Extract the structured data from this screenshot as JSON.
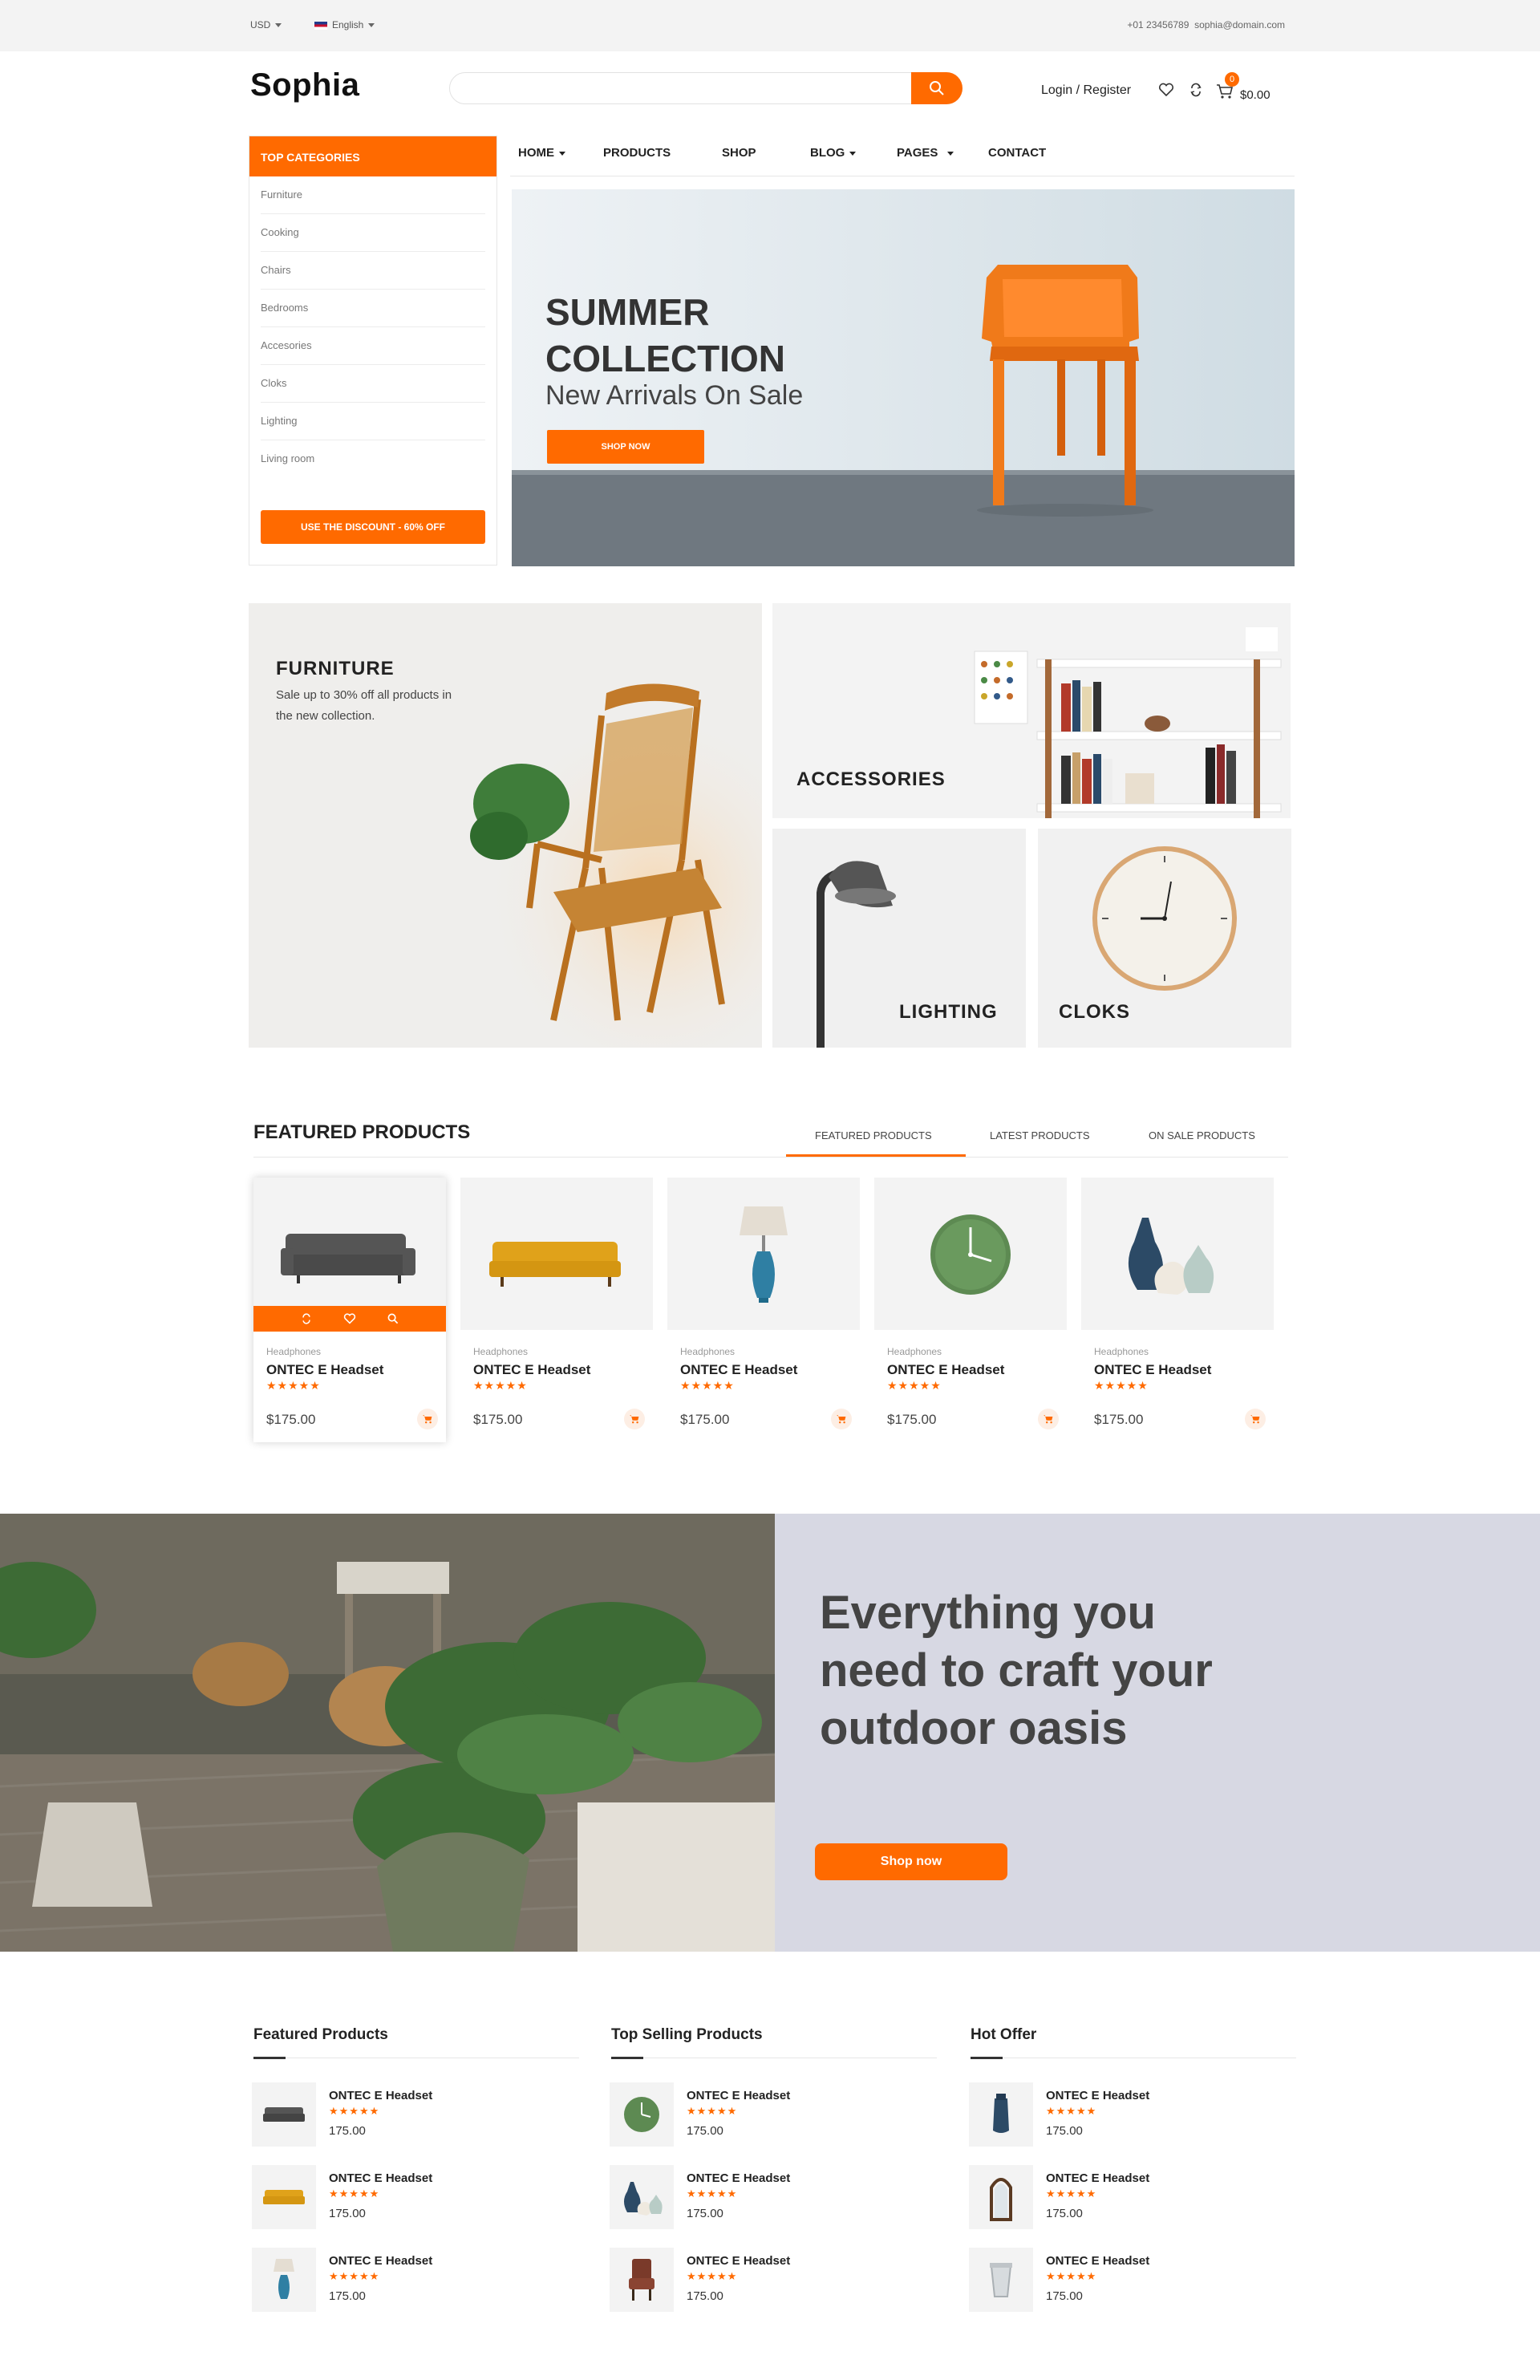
{
  "topbar": {
    "currency": "USD",
    "language": "English",
    "phone": "+01 23456789",
    "email": "sophia@domain.com"
  },
  "header": {
    "logo": "Sophia",
    "search_placeholder": "",
    "login": "Login / Register",
    "cart_count": "0",
    "cart_total": "$0.00"
  },
  "sidebar": {
    "title": "TOP CATEGORIES",
    "items": [
      "Furniture",
      "Cooking",
      "Chairs",
      "Bedrooms",
      "Accesories",
      "Cloks",
      "Lighting",
      "Living room"
    ],
    "discount_button": "USE THE DISCOUNT - 60% OFF"
  },
  "nav": {
    "items": [
      "HOME",
      "PRODUCTS",
      "SHOP",
      "BLOG",
      "PAGES",
      "CONTACT"
    ]
  },
  "hero": {
    "title": "SUMMER COLLECTION",
    "subtitle": "New Arrivals On Sale",
    "button": "SHOP NOW"
  },
  "banners": {
    "furniture_title": "FURNITURE",
    "furniture_desc": "Sale up to 30% off all products in the new collection.",
    "accessories": "ACCESSORIES",
    "lighting": "LIGHTING",
    "cloks": "CLOKS"
  },
  "featured": {
    "title": "FEATURED PRODUCTS",
    "tabs": [
      "FEATURED PRODUCTS",
      "LATEST PRODUCTS",
      "ON SALE PRODUCTS"
    ],
    "products": [
      {
        "category": "Headphones",
        "name": "ONTEC E Headset",
        "stars": "★★★★★",
        "price": "$175.00",
        "icon": "sofa-grey"
      },
      {
        "category": "Headphones",
        "name": "ONTEC E Headset",
        "stars": "★★★★★",
        "price": "$175.00",
        "icon": "sofa-yellow"
      },
      {
        "category": "Headphones",
        "name": "ONTEC E Headset",
        "stars": "★★★★★",
        "price": "$175.00",
        "icon": "table-lamp"
      },
      {
        "category": "Headphones",
        "name": "ONTEC E Headset",
        "stars": "★★★★★",
        "price": "$175.00",
        "icon": "wall-clock"
      },
      {
        "category": "Headphones",
        "name": "ONTEC E Headset",
        "stars": "★★★★★",
        "price": "$175.00",
        "icon": "vases"
      }
    ]
  },
  "outdoor": {
    "title": "Everything you need to craft your outdoor oasis",
    "button": "Shop now"
  },
  "lists": [
    {
      "title": "Featured Products",
      "items": [
        {
          "name": "ONTEC E Headset",
          "stars": "★★★★★",
          "price": "175.00",
          "icon": "sofa-grey"
        },
        {
          "name": "ONTEC E Headset",
          "stars": "★★★★★",
          "price": "175.00",
          "icon": "sofa-yellow"
        },
        {
          "name": "ONTEC E Headset",
          "stars": "★★★★★",
          "price": "175.00",
          "icon": "table-lamp"
        }
      ]
    },
    {
      "title": "Top Selling Products",
      "items": [
        {
          "name": "ONTEC E Headset",
          "stars": "★★★★★",
          "price": "175.00",
          "icon": "wall-clock"
        },
        {
          "name": "ONTEC E Headset",
          "stars": "★★★★★",
          "price": "175.00",
          "icon": "vases"
        },
        {
          "name": "ONTEC E Headset",
          "stars": "★★★★★",
          "price": "175.00",
          "icon": "armchair"
        }
      ]
    },
    {
      "title": "Hot Offer",
      "items": [
        {
          "name": "ONTEC E Headset",
          "stars": "★★★★★",
          "price": "175.00",
          "icon": "blue-vase"
        },
        {
          "name": "ONTEC E Headset",
          "stars": "★★★★★",
          "price": "175.00",
          "icon": "mirror"
        },
        {
          "name": "ONTEC E Headset",
          "stars": "★★★★★",
          "price": "175.00",
          "icon": "glass-bin"
        }
      ]
    }
  ],
  "colors": {
    "accent": "#ff6a00",
    "outdoor_bg": "#d7d8e3"
  }
}
